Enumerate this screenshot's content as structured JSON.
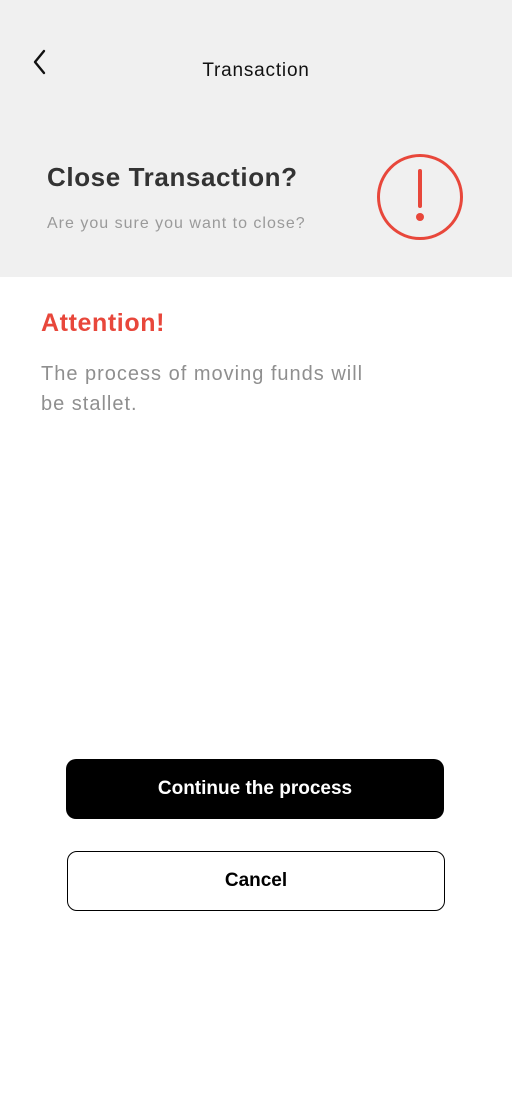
{
  "header": {
    "title": "Transaction",
    "back_icon": "chevron-left-icon"
  },
  "dialog": {
    "title": "Close Transaction?",
    "subtitle": "Are you sure you want to close?",
    "icon": "exclamation-circle-icon",
    "accent_color": "#e8473b"
  },
  "attention": {
    "title": "Attention!",
    "message": "The process of moving funds will be stallet."
  },
  "actions": {
    "continue_label": "Continue the process",
    "cancel_label": "Cancel"
  }
}
